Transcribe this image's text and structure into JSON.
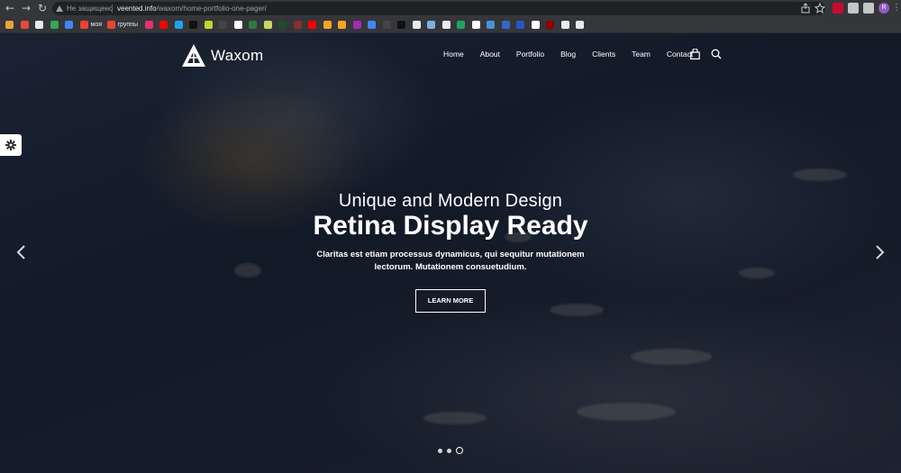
{
  "browser": {
    "back_glyph": "←",
    "forward_glyph": "→",
    "reload_glyph": "↻",
    "security_label": "Не защищено",
    "url_host": "veented.info",
    "url_path": "/waxom/home-portfolio-one-pager/",
    "profile_initial": "R",
    "bookmarks": [
      {
        "label": "",
        "color": "#e8a23a"
      },
      {
        "label": "",
        "color": "#e34a3a"
      },
      {
        "label": "",
        "color": "#e8eaed"
      },
      {
        "label": "",
        "color": "#34a853"
      },
      {
        "label": "",
        "color": "#4285f4"
      },
      {
        "label": "моя",
        "color": "#ea4335"
      },
      {
        "label": "группы",
        "color": "#ea4335"
      },
      {
        "label": "",
        "color": "#e1306c"
      },
      {
        "label": "",
        "color": "#ff0000"
      },
      {
        "label": "",
        "color": "#1da1f2"
      },
      {
        "label": "",
        "color": "#111111"
      },
      {
        "label": "",
        "color": "#c5d52b"
      },
      {
        "label": "",
        "color": "#444444"
      },
      {
        "label": "",
        "color": "#ffffff"
      },
      {
        "label": "",
        "color": "#2d7a3e"
      },
      {
        "label": "",
        "color": "#c8d66a"
      },
      {
        "label": "",
        "color": "#1e4d2b"
      },
      {
        "label": "",
        "color": "#8b2e2e"
      },
      {
        "label": "",
        "color": "#ff0000"
      },
      {
        "label": "",
        "color": "#f4a422"
      },
      {
        "label": "",
        "color": "#f4a422"
      },
      {
        "label": "",
        "color": "#a52ab5"
      },
      {
        "label": "",
        "color": "#4285f4"
      },
      {
        "label": "",
        "color": "#444444"
      },
      {
        "label": "",
        "color": "#111111"
      },
      {
        "label": "",
        "color": "#e8eaed"
      },
      {
        "label": "",
        "color": "#7ab0e0"
      },
      {
        "label": "",
        "color": "#e8eaed"
      },
      {
        "label": "",
        "color": "#1da462"
      },
      {
        "label": "",
        "color": "#ffffff"
      },
      {
        "label": "",
        "color": "#4a90e2"
      },
      {
        "label": "",
        "color": "#3366cc"
      },
      {
        "label": "",
        "color": "#2357c5"
      },
      {
        "label": "",
        "color": "#ffffff"
      },
      {
        "label": "",
        "color": "#8b0000"
      },
      {
        "label": "",
        "color": "#e8eaed"
      },
      {
        "label": "",
        "color": "#e8eaed"
      }
    ],
    "extensions": [
      {
        "name": "adblock-plus-icon",
        "color": "#c70d2c"
      },
      {
        "name": "extensions-puzzle-icon",
        "color": "#c4c7c5"
      },
      {
        "name": "sidepanel-icon",
        "color": "#c4c7c5"
      }
    ]
  },
  "site": {
    "brand": "Waxom",
    "nav": [
      "Home",
      "About",
      "Portfolio",
      "Blog",
      "Clients",
      "Team",
      "Contact"
    ]
  },
  "hero": {
    "subtitle": "Unique and Modern Design",
    "title": "Retina Display Ready",
    "description": "Claritas est etiam processus dynamicus, qui sequitur mutationem lectorum. Mutationem consuetudium.",
    "cta_label": "LEARN MORE",
    "slide_count": 3,
    "active_slide": 3
  },
  "colors": {
    "accent": "#ffffff",
    "overlay": "#151c2a"
  }
}
